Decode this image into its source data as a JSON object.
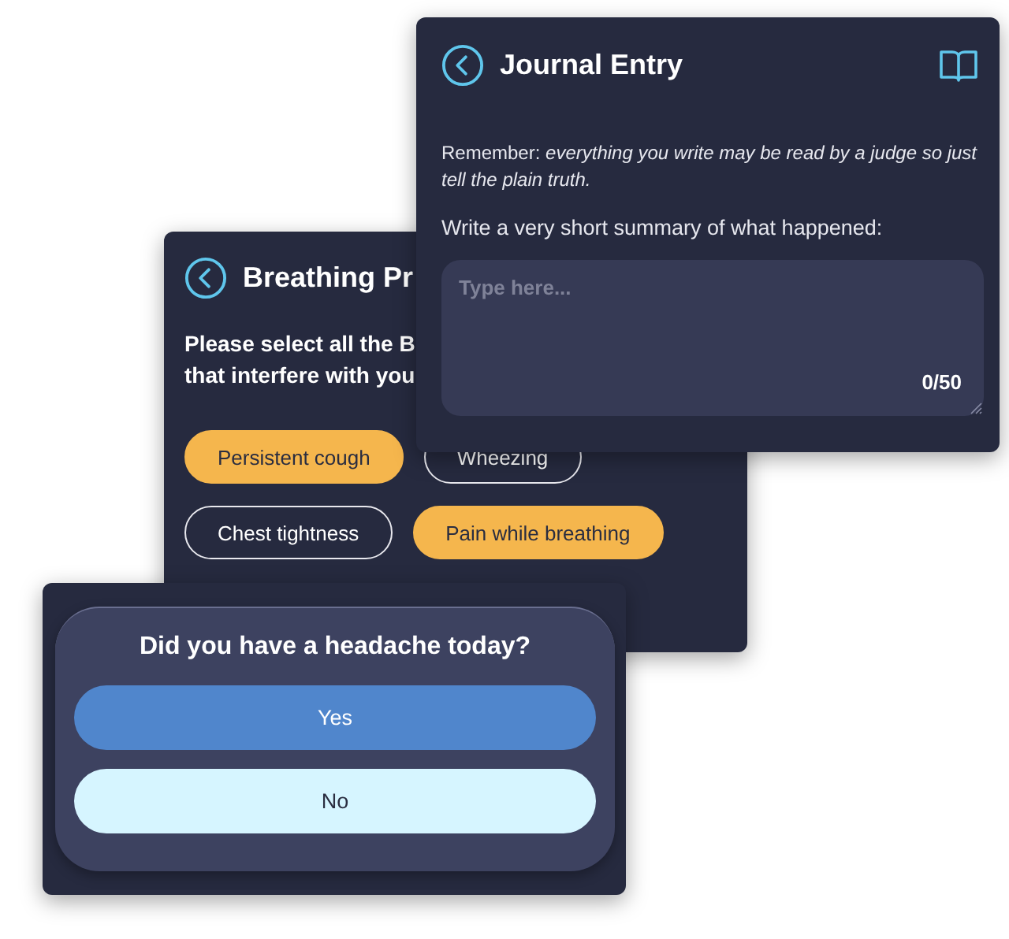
{
  "breathing_card": {
    "title": "Breathing Pr",
    "question_lines": [
      "Please select all the B",
      "that interfere with you"
    ],
    "options": [
      {
        "label": "Persistent cough",
        "selected": true
      },
      {
        "label": "Wheezing",
        "selected": false
      },
      {
        "label": "Chest tightness",
        "selected": false
      },
      {
        "label": "Pain while breathing",
        "selected": true
      }
    ]
  },
  "journal_card": {
    "title": "Journal Entry",
    "reminder": "Remember: *everything you write may be read by a judge so just tell the plain truth.*",
    "prompt": "Write a very short summary of what happened:",
    "placeholder": "Type here...",
    "counter": "0/50"
  },
  "headache_card": {
    "question": "Did you have a headache today?",
    "answers": [
      {
        "label": "Yes",
        "selected": true
      },
      {
        "label": "No",
        "selected": false
      }
    ]
  }
}
